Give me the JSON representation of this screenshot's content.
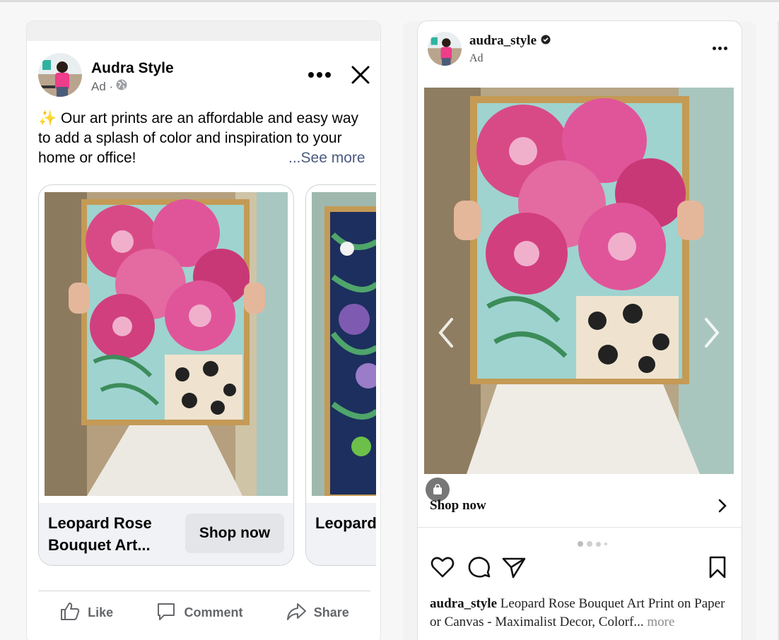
{
  "facebook": {
    "page_name": "Audra Style",
    "ad_label": "Ad ·",
    "post_text": "✨ Our art prints are an affordable and easy way to add a splash of color and inspiration to your home or office!",
    "see_more": "...See more",
    "cards": [
      {
        "title": "Leopard Rose Bouquet Art...",
        "button": "Shop now"
      },
      {
        "title": "Leopard Rose Vase wi"
      }
    ],
    "actions": {
      "like": "Like",
      "comment": "Comment",
      "share": "Share"
    }
  },
  "instagram": {
    "username": "audra_style",
    "ad_label": "Ad",
    "shop_now": "Shop now",
    "caption_user": "audra_style",
    "caption_text": " Leopard Rose Bouquet Art Print on Paper or Canvas - Maximalist Decor, Colorf...",
    "caption_more": " more",
    "carousel_count": 4,
    "carousel_active": 1
  },
  "colors": {
    "fb_link": "#4b5a81",
    "fb_muted": "#65676b",
    "ig_more": "#8e8e8e"
  },
  "icons": [
    "globe-icon",
    "more-icon",
    "close-icon",
    "like-icon",
    "comment-icon",
    "share-icon",
    "verified-icon",
    "chevron-left-icon",
    "chevron-right-icon",
    "shopping-bag-icon",
    "heart-icon",
    "direct-icon",
    "bookmark-icon"
  ]
}
